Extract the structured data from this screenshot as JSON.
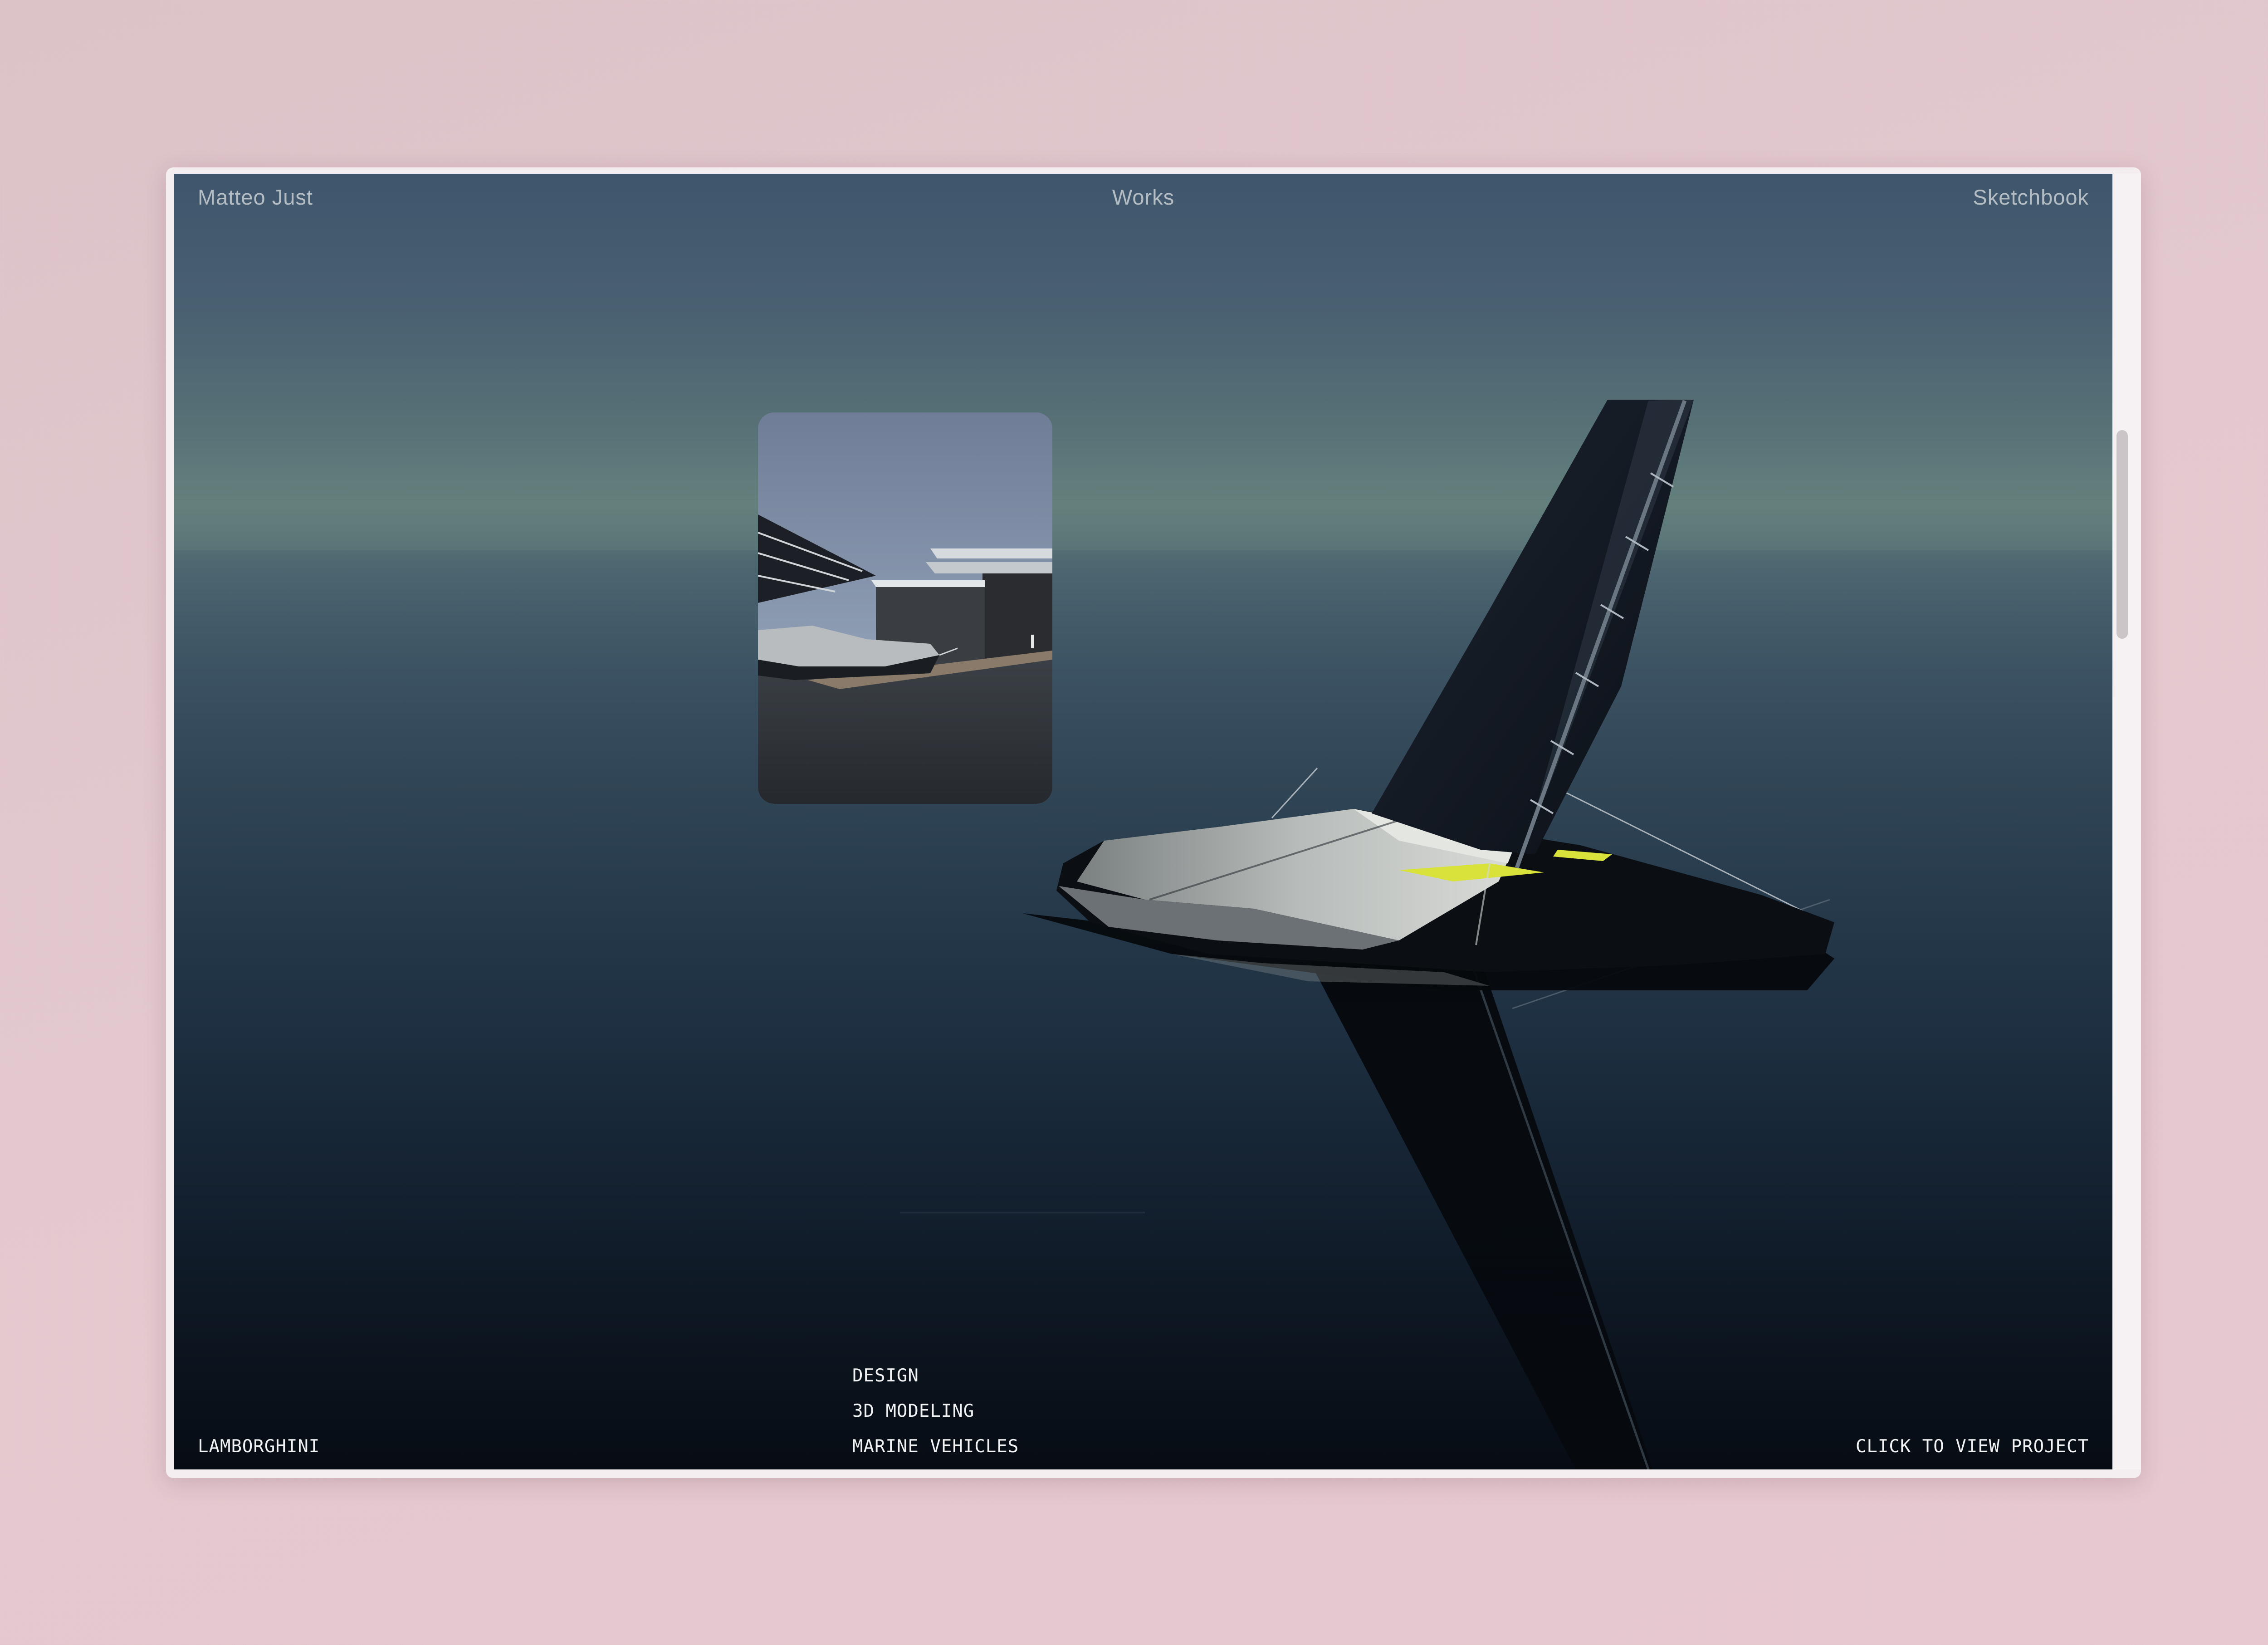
{
  "header": {
    "brand": "Matteo  Just",
    "center_link": "Works",
    "right_link": "Sketchbook"
  },
  "project": {
    "client": "LAMBORGHINI",
    "tags": [
      "DESIGN",
      "3D MODELING",
      "MARINE VEHICLES"
    ],
    "cta": "CLICK TO VIEW PROJECT"
  },
  "media": {
    "hero": "sailing yacht render (hull, mast and sail reflected on water)",
    "thumbnail": "yacht moored at dock next to a building"
  },
  "colors": {
    "page_background": "#e3c8cd",
    "sky_top": "#3f556c",
    "water_bottom": "#070c14",
    "nav_text": "#b4bdc3",
    "label_text": "#f1f3f5",
    "accent_yellow": "#d8e23a"
  }
}
